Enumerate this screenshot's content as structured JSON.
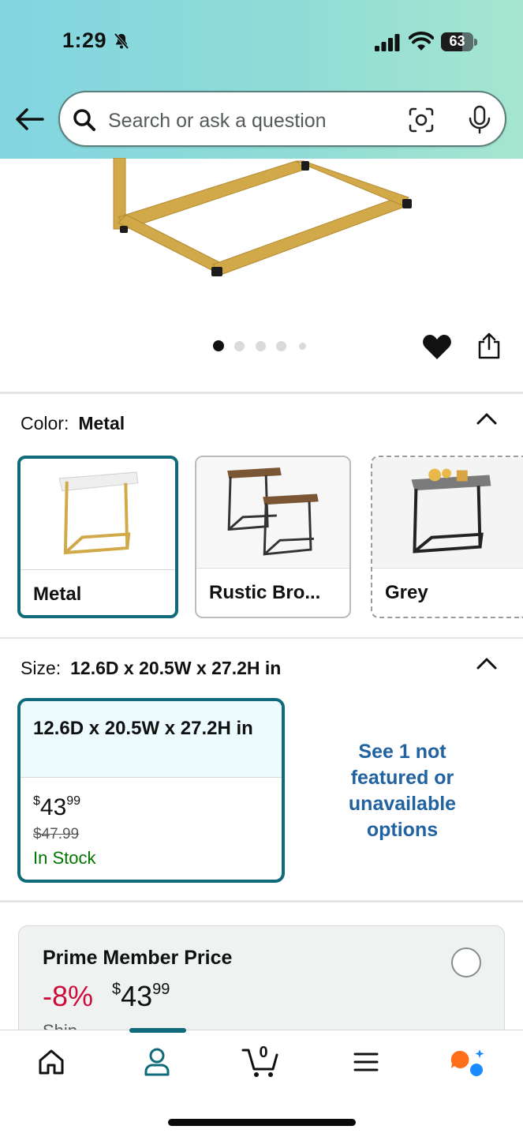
{
  "status_bar": {
    "time": "1:29",
    "battery": "63"
  },
  "search": {
    "placeholder": "Search or ask a question"
  },
  "gallery": {
    "dots": 5,
    "active_dot": 0
  },
  "color": {
    "label": "Color:",
    "value": "Metal",
    "options": [
      {
        "name": "Metal",
        "selected": true
      },
      {
        "name": "Rustic Bro...",
        "selected": false
      },
      {
        "name": "Grey",
        "selected": false
      }
    ]
  },
  "size": {
    "label": "Size:",
    "value": "12.6D x 20.5W x 27.2H in",
    "card": {
      "name": "12.6D x 20.5W x 27.2H in",
      "price_symbol": "$",
      "price_whole": "43",
      "price_fraction": "99",
      "list_price": "$47.99",
      "availability": "In Stock"
    },
    "see_more": "See 1 not featured or unavailable options"
  },
  "prime": {
    "title": "Prime Member Price",
    "discount": "-8%",
    "price_symbol": "$",
    "price_whole": "43",
    "price_fraction": "99",
    "cut_text": "Ship..."
  },
  "nav": {
    "items": [
      "home-icon",
      "account-icon",
      "cart-icon",
      "menu-icon",
      "rufus-icon"
    ],
    "cart_count": "0",
    "active": "account-icon"
  },
  "colors": {
    "accent": "#0f6b79",
    "link": "#2162a1",
    "in_stock": "#007600",
    "deal": "#cc0c39",
    "header_start": "#82d5e1",
    "header_end": "#a6e6d0"
  }
}
